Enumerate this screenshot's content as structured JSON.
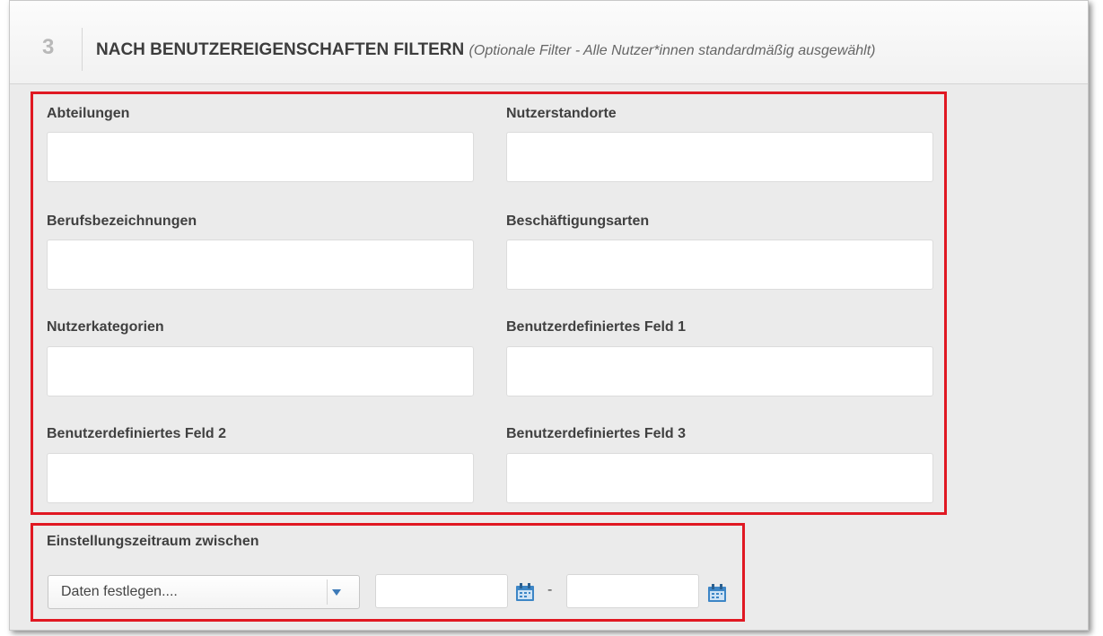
{
  "header": {
    "step_number": "3",
    "title": "NACH BENUTZEREIGENSCHAFTEN FILTERN",
    "subtitle": "(Optionale Filter - Alle Nutzer*innen standardmäßig ausgewählt)"
  },
  "fields": {
    "departments": {
      "label": "Abteilungen",
      "value": ""
    },
    "locations": {
      "label": "Nutzerstandorte",
      "value": ""
    },
    "job_titles": {
      "label": "Berufsbezeichnungen",
      "value": ""
    },
    "employment_types": {
      "label": "Beschäftigungsarten",
      "value": ""
    },
    "user_categories": {
      "label": "Nutzerkategorien",
      "value": ""
    },
    "custom_field_1": {
      "label": "Benutzerdefiniertes Feld 1",
      "value": ""
    },
    "custom_field_2": {
      "label": "Benutzerdefiniertes Feld 2",
      "value": ""
    },
    "custom_field_3": {
      "label": "Benutzerdefiniertes Feld 3",
      "value": ""
    }
  },
  "hire_period": {
    "label": "Einstellungszeitraum zwischen",
    "select_value": "Daten festlegen....",
    "separator": "-",
    "start_date": "",
    "end_date": ""
  },
  "icons": {
    "dropdown": "chevron-down-icon",
    "calendar": "calendar-icon"
  },
  "colors": {
    "highlight": "#e01822",
    "accent": "#3d7ab8",
    "panel_bg": "#ebebeb"
  }
}
